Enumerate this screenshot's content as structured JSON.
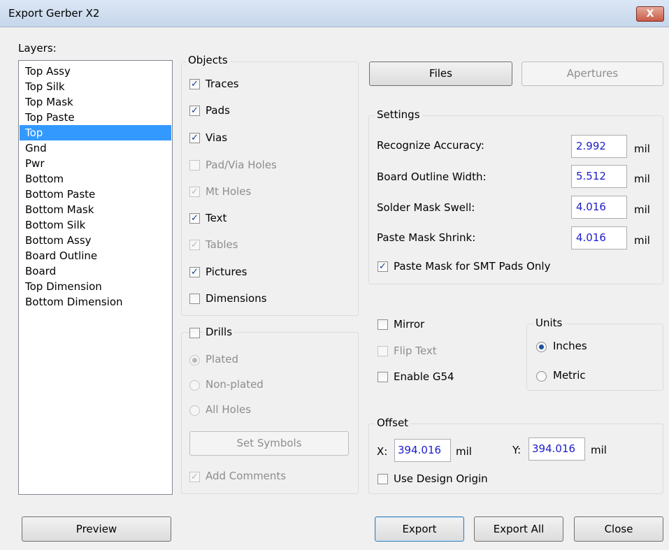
{
  "window": {
    "title": "Export Gerber X2",
    "close_label": "X"
  },
  "layers": {
    "label": "Layers:",
    "items": [
      "Top Assy",
      "Top Silk",
      "Top Mask",
      "Top Paste",
      "Top",
      "Gnd",
      "Pwr",
      "Bottom",
      "Bottom Paste",
      "Bottom Mask",
      "Bottom Silk",
      "Bottom Assy",
      "Board Outline",
      "Board",
      "Top Dimension",
      "Bottom Dimension"
    ],
    "selected": "Top"
  },
  "objects": {
    "title": "Objects",
    "items": [
      {
        "label": "Traces",
        "checked": true,
        "enabled": true
      },
      {
        "label": "Pads",
        "checked": true,
        "enabled": true
      },
      {
        "label": "Vias",
        "checked": true,
        "enabled": true
      },
      {
        "label": "Pad/Via Holes",
        "checked": false,
        "enabled": false
      },
      {
        "label": "Mt Holes",
        "checked": true,
        "enabled": false
      },
      {
        "label": "Text",
        "checked": true,
        "enabled": true
      },
      {
        "label": "Tables",
        "checked": true,
        "enabled": false
      },
      {
        "label": "Pictures",
        "checked": true,
        "enabled": true
      },
      {
        "label": "Dimensions",
        "checked": false,
        "enabled": true
      }
    ]
  },
  "drills": {
    "title": "Drills",
    "checked": false,
    "options": [
      {
        "label": "Plated",
        "selected": true
      },
      {
        "label": "Non-plated",
        "selected": false
      },
      {
        "label": "All Holes",
        "selected": false
      }
    ],
    "set_symbols_label": "Set Symbols",
    "add_comments_label": "Add Comments",
    "add_comments_checked": true
  },
  "buttons": {
    "files": "Files",
    "apertures": "Apertures",
    "preview": "Preview",
    "export": "Export",
    "export_all": "Export All",
    "close": "Close"
  },
  "settings": {
    "title": "Settings",
    "rows": [
      {
        "label": "Recognize Accuracy:",
        "value": "2.992",
        "unit": "mil"
      },
      {
        "label": "Board Outline Width:",
        "value": "5.512",
        "unit": "mil"
      },
      {
        "label": "Solder Mask Swell:",
        "value": "4.016",
        "unit": "mil"
      },
      {
        "label": "Paste Mask Shrink:",
        "value": "4.016",
        "unit": "mil"
      }
    ],
    "paste_mask_smt_label": "Paste Mask for SMT Pads Only",
    "paste_mask_smt_checked": true
  },
  "options": {
    "mirror_label": "Mirror",
    "mirror_checked": false,
    "flip_text_label": "Flip Text",
    "flip_text_checked": false,
    "enable_g54_label": "Enable G54",
    "enable_g54_checked": false
  },
  "units": {
    "title": "Units",
    "inches_label": "Inches",
    "inches_selected": true,
    "metric_label": "Metric",
    "metric_selected": false
  },
  "offset": {
    "title": "Offset",
    "x_label": "X:",
    "x_value": "394.016",
    "x_unit": "mil",
    "y_label": "Y:",
    "y_value": "394.016",
    "y_unit": "mil",
    "use_design_origin_label": "Use Design Origin",
    "use_design_origin_checked": false
  }
}
